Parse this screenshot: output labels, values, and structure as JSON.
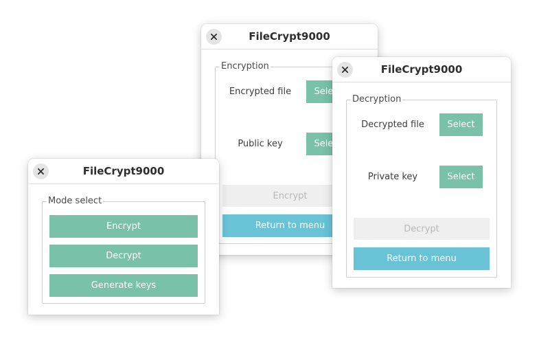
{
  "encrypt_window": {
    "title": "FileCrypt9000",
    "group_label": "Encryption",
    "encrypted_file_label": "Encrypted file",
    "encrypted_file_button": "Select",
    "public_key_label": "Public key",
    "public_key_button": "Select",
    "action_button": "Encrypt",
    "return_button": "Return to menu"
  },
  "decrypt_window": {
    "title": "FileCrypt9000",
    "group_label": "Decryption",
    "decrypted_file_label": "Decrypted file",
    "decrypted_file_button": "Select",
    "private_key_label": "Private key",
    "private_key_button": "Select",
    "action_button": "Decrypt",
    "return_button": "Return to menu"
  },
  "menu_window": {
    "title": "FileCrypt9000",
    "group_label": "Mode select",
    "buttons": [
      "Encrypt",
      "Decrypt",
      "Generate keys"
    ]
  },
  "colors": {
    "select_button": "#79c1a8",
    "return_button": "#68c3d6",
    "disabled_button": "#efefef"
  }
}
